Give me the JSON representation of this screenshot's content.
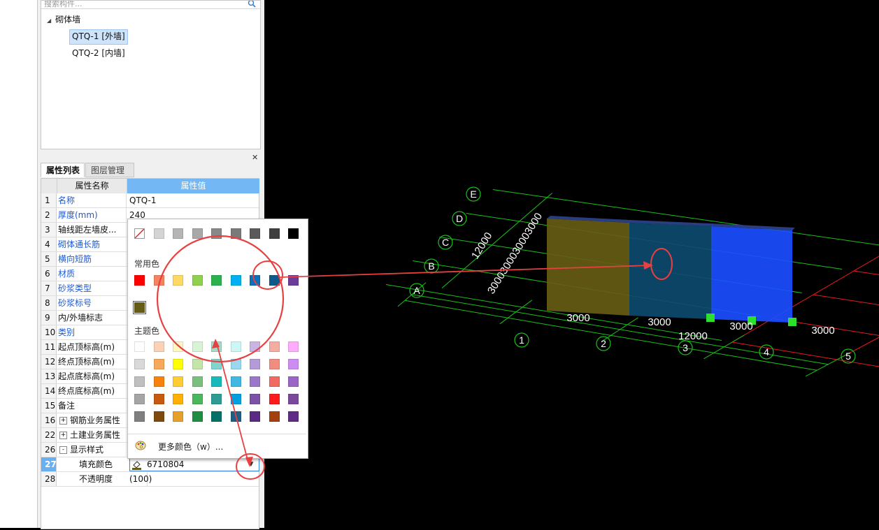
{
  "search": {
    "placeholder": "搜索构件..."
  },
  "tree": {
    "root_label": "砌体墙",
    "items": [
      {
        "label": "QTQ-1 [外墙]",
        "selected": true
      },
      {
        "label": "QTQ-2 [内墙]",
        "selected": false
      }
    ]
  },
  "tabs": {
    "properties": "属性列表",
    "layers": "图层管理"
  },
  "grid": {
    "col_name": "属性名称",
    "col_value": "属性值",
    "rows": [
      {
        "num": "1",
        "name": "名称",
        "value": "QTQ-1",
        "blue": true
      },
      {
        "num": "2",
        "name": "厚度(mm)",
        "value": "240",
        "blue": true
      },
      {
        "num": "3",
        "name": "轴线距左墙皮...",
        "value": "",
        "blue": false
      },
      {
        "num": "4",
        "name": "砌体通长筋",
        "value": "",
        "blue": true
      },
      {
        "num": "5",
        "name": "横向短筋",
        "value": "",
        "blue": true
      },
      {
        "num": "6",
        "name": "材质",
        "value": "",
        "blue": true
      },
      {
        "num": "7",
        "name": "砂浆类型",
        "value": "",
        "blue": true
      },
      {
        "num": "8",
        "name": "砂浆标号",
        "value": "",
        "blue": true
      },
      {
        "num": "9",
        "name": "内/外墙标志",
        "value": "",
        "blue": false
      },
      {
        "num": "10",
        "name": "类别",
        "value": "",
        "blue": true
      },
      {
        "num": "11",
        "name": "起点顶标高(m)",
        "value": "",
        "blue": false
      },
      {
        "num": "12",
        "name": "终点顶标高(m)",
        "value": "",
        "blue": false
      },
      {
        "num": "13",
        "name": "起点底标高(m)",
        "value": "",
        "blue": false
      },
      {
        "num": "14",
        "name": "终点底标高(m)",
        "value": "",
        "blue": false
      },
      {
        "num": "15",
        "name": "备注",
        "value": "",
        "blue": false
      },
      {
        "num": "16",
        "name": "钢筋业务属性",
        "value": "",
        "blue": false,
        "expander": "+"
      },
      {
        "num": "22",
        "name": "土建业务属性",
        "value": "",
        "blue": false,
        "expander": "+"
      },
      {
        "num": "26",
        "name": "显示样式",
        "value": "",
        "blue": false,
        "expander": "-"
      },
      {
        "num": "27",
        "name": "填充颜色",
        "value": "6710804",
        "blue": false,
        "child": true,
        "selected": true
      },
      {
        "num": "28",
        "name": "不透明度",
        "value": "(100)",
        "blue": false,
        "child": true
      }
    ]
  },
  "color_popup": {
    "common_label": "常用色",
    "theme_label": "主题色",
    "more_colors": "更多颜色（w）...",
    "gray_row": [
      "none",
      "#d4d4d4",
      "#b5b5b5",
      "#a8a8a8",
      "#888888",
      "#7a7a7a",
      "#5a5a5a",
      "#3f3f3f",
      "#000000"
    ],
    "common_row": [
      "#ff0000",
      "#f4845f",
      "#ffd866",
      "#8fd14f",
      "#2db14f",
      "#00b0f0",
      "#0b6fba",
      "#0d5a8a",
      "#6a3d9a"
    ],
    "recent": [
      "#665c14"
    ],
    "theme_rows": [
      [
        "#ffffff",
        "#fbd2b5",
        "#fff7c2",
        "#d7f5d5",
        "#a6d9c8",
        "#cff6f7",
        "#c9b4e4",
        "#f4aea1",
        "#ffacff"
      ],
      [
        "#d9d9d9",
        "#f8a85a",
        "#ffff00",
        "#c3e6a8",
        "#7fd6d1",
        "#9ad8ee",
        "#b49ad8",
        "#f08d7e",
        "#cc8cf2"
      ],
      [
        "#bfbfbf",
        "#f7820e",
        "#ffcc33",
        "#7bbf7e",
        "#17b9b9",
        "#41b7e3",
        "#9b77cc",
        "#f06a62",
        "#9966c8"
      ],
      [
        "#a5a5a5",
        "#c65a11",
        "#ffb000",
        "#4bb75c",
        "#2e9c93",
        "#00a0e0",
        "#7b52a6",
        "#ff1b1b",
        "#7a4a9a"
      ],
      [
        "#7f7f7f",
        "#7f4a0e",
        "#e6a02a",
        "#1f8e42",
        "#057068",
        "#1e5f86",
        "#5b2a84",
        "#a43f10",
        "#5f2c86"
      ]
    ]
  },
  "viewport": {
    "axis_letters": [
      "A",
      "B",
      "C",
      "D",
      "E"
    ],
    "axis_numbers": [
      "1",
      "2",
      "3",
      "4",
      "5"
    ],
    "dim_bottom": [
      "3000",
      "3000",
      "3000",
      "3000"
    ],
    "dim_bottom_total": "12000",
    "dim_left_total": "12000",
    "dim_left_stack": "3000300030003000",
    "wall_colors": [
      "#665c14",
      "#0d4a6e",
      "#1a4eff"
    ]
  }
}
